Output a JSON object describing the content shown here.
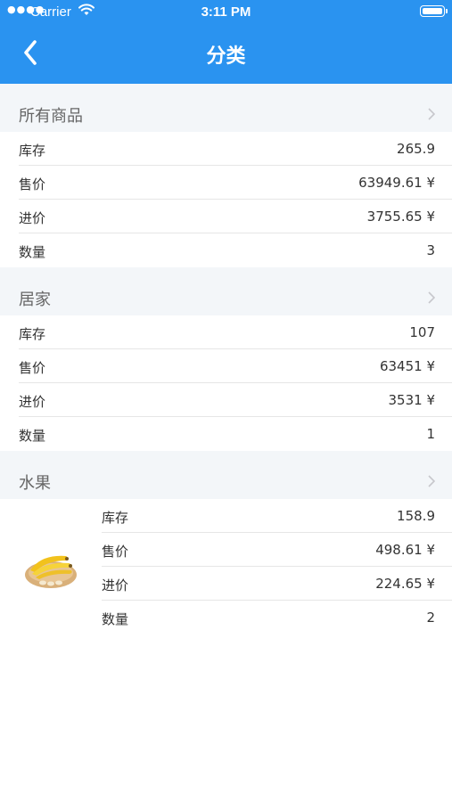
{
  "status_bar": {
    "carrier": "Carrier",
    "time": "3:11 PM"
  },
  "nav": {
    "title": "分类",
    "back_icon": "chevron-left-icon"
  },
  "sections": [
    {
      "title": "所有商品",
      "rows": [
        {
          "label": "库存",
          "value": "265.9"
        },
        {
          "label": "售价",
          "value": "63949.61 ¥"
        },
        {
          "label": "进价",
          "value": "3755.65 ¥"
        },
        {
          "label": "数量",
          "value": "3"
        }
      ]
    },
    {
      "title": "居家",
      "rows": [
        {
          "label": "库存",
          "value": "107"
        },
        {
          "label": "售价",
          "value": "63451 ¥"
        },
        {
          "label": "进价",
          "value": "3531 ¥"
        },
        {
          "label": "数量",
          "value": "1"
        }
      ]
    },
    {
      "title": "水果",
      "image": "banana-plate-image",
      "rows": [
        {
          "label": "库存",
          "value": "158.9"
        },
        {
          "label": "售价",
          "value": "498.61 ¥"
        },
        {
          "label": "进价",
          "value": "224.65 ¥"
        },
        {
          "label": "数量",
          "value": "2"
        }
      ]
    }
  ],
  "colors": {
    "nav_bar": "#2a93f0",
    "section_header_bg": "#f3f6f9",
    "chevron": "#c7c7cc"
  }
}
